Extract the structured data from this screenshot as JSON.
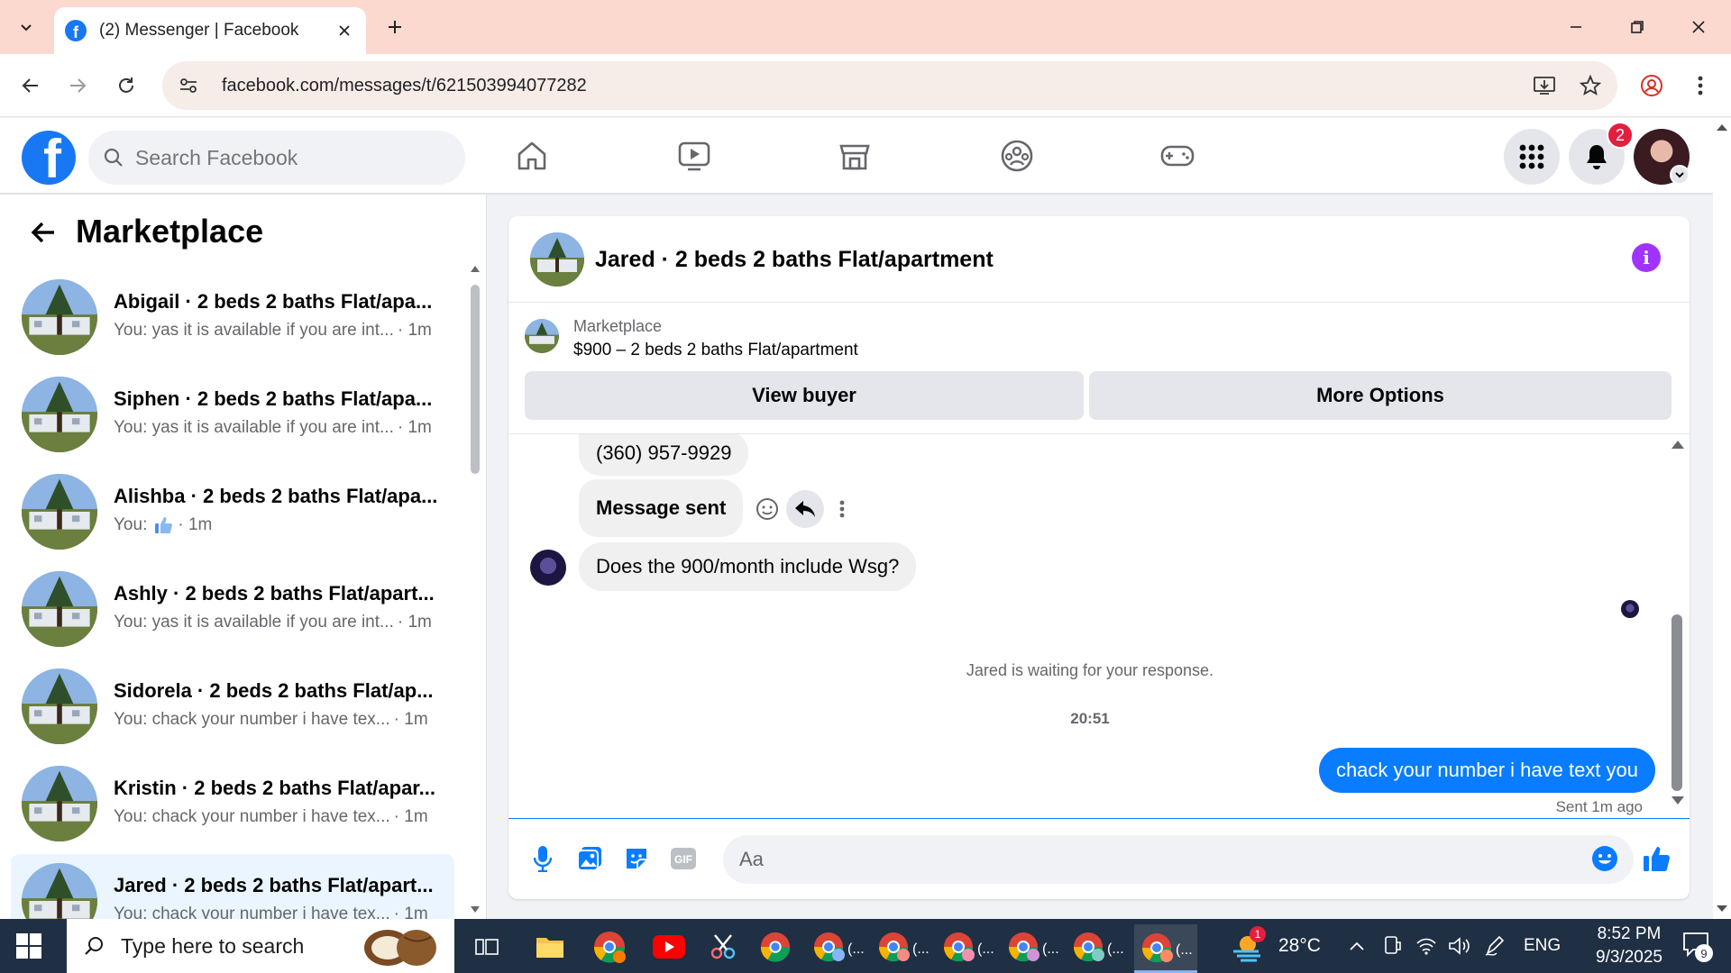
{
  "browser": {
    "tab_title": "(2) Messenger | Facebook",
    "url": "facebook.com/messages/t/621503994077282"
  },
  "facebook": {
    "search_placeholder": "Search Facebook",
    "notification_count": "2"
  },
  "sidebar": {
    "title": "Marketplace",
    "conversations": [
      {
        "name": "Abigail · 2 beds 2 baths Flat/apa...",
        "preview": "You: yas it is available if you are int...",
        "time": "· 1m",
        "active": false
      },
      {
        "name": "Siphen · 2 beds 2 baths Flat/apa...",
        "preview": "You: yas it is available if you are int...",
        "time": "· 1m",
        "active": false
      },
      {
        "name": "Alishba · 2 beds 2 baths Flat/apa...",
        "preview": "You:",
        "time": "· 1m",
        "has_thumb": true,
        "active": false
      },
      {
        "name": "Ashly · 2 beds 2 baths Flat/apart...",
        "preview": "You: yas it is available if you are int...",
        "time": "· 1m",
        "active": false
      },
      {
        "name": "Sidorela · 2 beds 2 baths Flat/ap...",
        "preview": "You: chack your number i have tex...",
        "time": "· 1m",
        "active": false
      },
      {
        "name": "Kristin · 2 beds 2 baths Flat/apar...",
        "preview": "You: chack your number i have tex...",
        "time": "· 1m",
        "active": false
      },
      {
        "name": "Jared · 2 beds 2 baths Flat/apart...",
        "preview": "You: chack your number i have tex...",
        "time": "· 1m",
        "active": true
      }
    ]
  },
  "chat": {
    "title": "Jared · 2 beds 2 baths Flat/apartment",
    "listing_label": "Marketplace",
    "listing_price": "$900 – 2 beds 2 baths Flat/apartment",
    "view_buyer_label": "View buyer",
    "more_options_label": "More Options",
    "messages": {
      "phone": "(360) 957-9929",
      "message_sent": "Message sent",
      "question": "Does the 900/month include Wsg?",
      "waiting_note": "Jared is waiting for your response.",
      "timestamp": "20:51",
      "reply": "chack your number i have text you",
      "sent_status": "Sent 1m ago"
    },
    "input_placeholder": "Aa"
  },
  "taskbar": {
    "search_placeholder": "Type here to search",
    "weather_temp": "28°C",
    "weather_badge": "1",
    "language": "ENG",
    "time": "8:52 PM",
    "date": "9/3/2025",
    "notification_count": "9"
  },
  "colors": {
    "brand": "#1877f2",
    "outgoing_bubble": "#0a7cff",
    "tab_strip": "#fbd9cf",
    "badge": "#e41e3f",
    "info": "#a033ff"
  }
}
